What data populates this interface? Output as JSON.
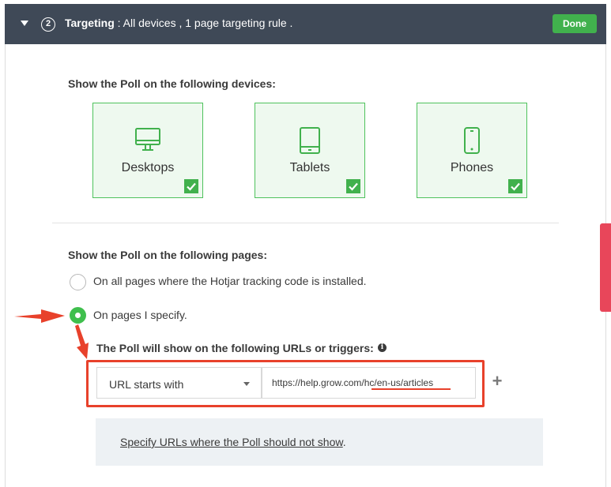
{
  "header": {
    "step_number": "2",
    "title_bold": "Targeting",
    "title_rest": " : All devices , 1 page targeting rule .",
    "done_label": "Done"
  },
  "devices": {
    "heading": "Show the Poll on the following devices:",
    "items": [
      {
        "label": "Desktops",
        "icon": "desktop-icon",
        "checked": true
      },
      {
        "label": "Tablets",
        "icon": "tablet-icon",
        "checked": true
      },
      {
        "label": "Phones",
        "icon": "phone-icon",
        "checked": true
      }
    ]
  },
  "pages": {
    "heading": "Show the Poll on the following pages:",
    "options": [
      {
        "label": "On all pages where the Hotjar tracking code is installed.",
        "selected": false
      },
      {
        "label": "On pages I specify.",
        "selected": true
      }
    ],
    "rules_heading": "The Poll will show on the following URLs or triggers:",
    "rule": {
      "match_type": "URL starts with",
      "url_value": "https://help.grow.com/hc/en-us/articles"
    },
    "exclude": {
      "link_text": "Specify URLs where the Poll should not show",
      "suffix": "."
    }
  },
  "colors": {
    "header_bg": "#3f4957",
    "accent_green": "#41b14d",
    "annotation_red": "#e8412b"
  }
}
